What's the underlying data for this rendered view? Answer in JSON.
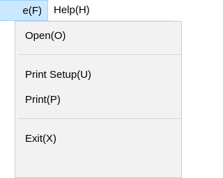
{
  "menubar": {
    "file_label": "e(F)",
    "help_label": "Help(H)"
  },
  "file_menu": {
    "items": [
      {
        "label": "Open(O)"
      },
      {
        "label": "Print Setup(U)"
      },
      {
        "label": "Print(P)"
      },
      {
        "label": "Exit(X)"
      }
    ]
  },
  "colors": {
    "menu_background": "#f2f2f2",
    "active_menubar_item": "#cce8ff",
    "active_menubar_border": "#99d1ff",
    "separator": "#d7d7d7"
  }
}
